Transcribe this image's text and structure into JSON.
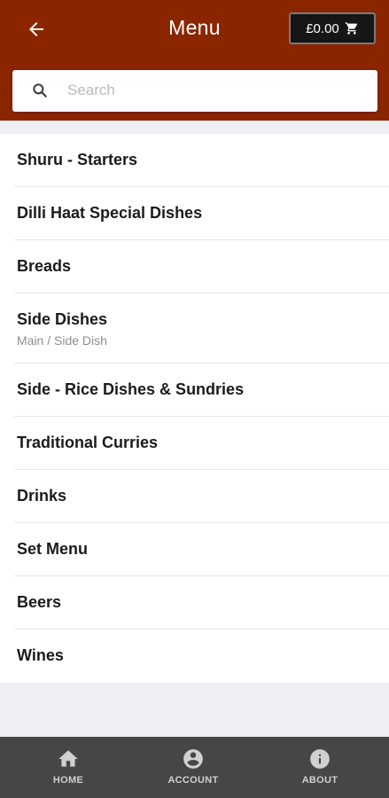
{
  "header": {
    "title": "Menu",
    "back_icon": "arrow-left-icon",
    "cart_total": "£0.00",
    "cart_icon": "shopping-cart-icon"
  },
  "search": {
    "placeholder": "Search",
    "value": "",
    "icon": "search-icon"
  },
  "categories": [
    {
      "label": "Shuru - Starters"
    },
    {
      "label": "Dilli Haat Special Dishes"
    },
    {
      "label": "Breads"
    },
    {
      "label": "Side Dishes",
      "subtitle": "Main / Side Dish"
    },
    {
      "label": "Side - Rice Dishes & Sundries"
    },
    {
      "label": "Traditional Curries"
    },
    {
      "label": "Drinks"
    },
    {
      "label": "Set Menu"
    },
    {
      "label": "Beers"
    },
    {
      "label": "Wines"
    }
  ],
  "tabbar": {
    "tabs": [
      {
        "label": "HOME",
        "icon": "home-icon"
      },
      {
        "label": "ACCOUNT",
        "icon": "account-icon"
      },
      {
        "label": "ABOUT",
        "icon": "info-icon"
      }
    ]
  },
  "colors": {
    "header_bg": "#8b2500",
    "page_bg": "#efeff4",
    "tabbar_bg": "#464646",
    "cart_bg": "#161616"
  }
}
